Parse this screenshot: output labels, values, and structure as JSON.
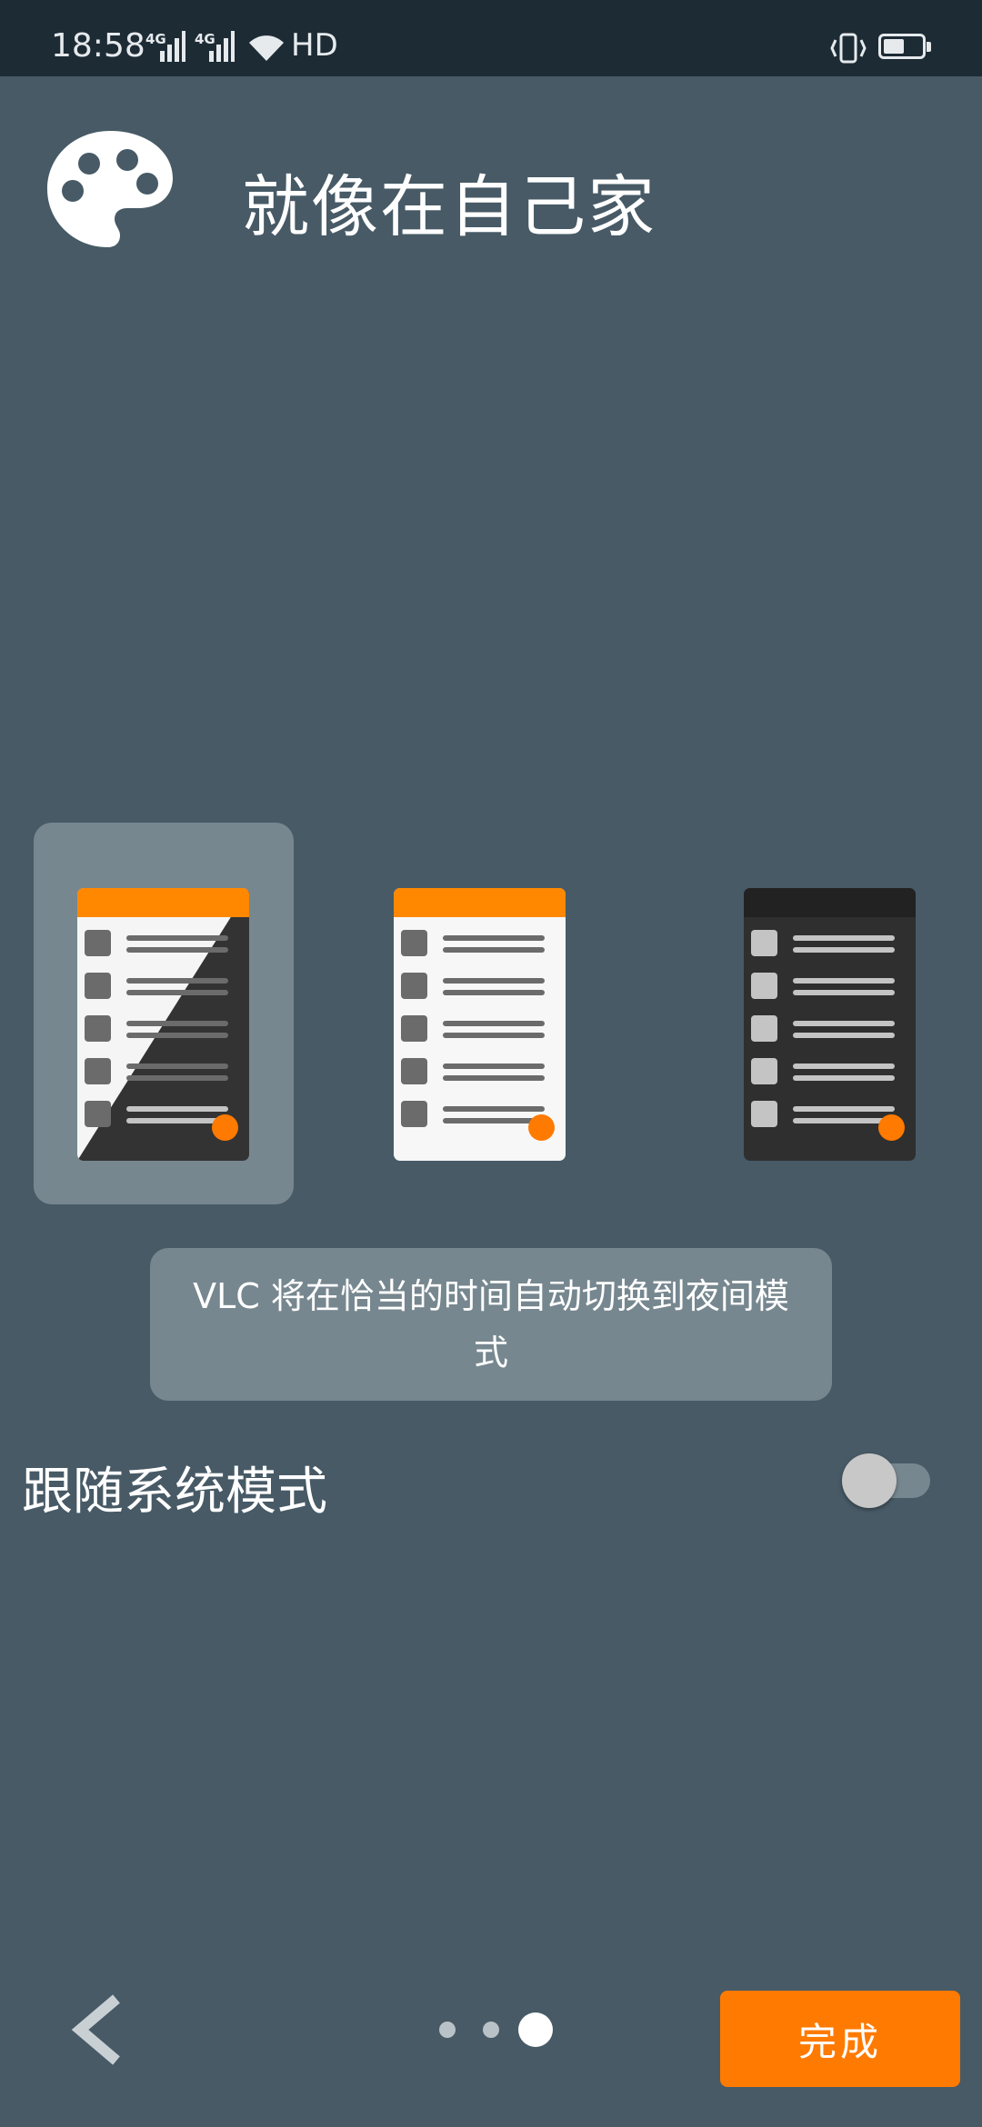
{
  "status_bar": {
    "time": "18:58",
    "net1": "4G",
    "net2": "4G",
    "hd": "HD"
  },
  "header": {
    "title": "就像在自己家",
    "icon": "palette-icon"
  },
  "themes": [
    {
      "name": "follow-daylight",
      "selected": true
    },
    {
      "name": "light",
      "selected": false
    },
    {
      "name": "dark",
      "selected": false
    }
  ],
  "info_text": "VLC 将在恰当的时间自动切换到夜间模式",
  "follow_system": {
    "label": "跟随系统模式",
    "enabled": false
  },
  "pagination": {
    "current": 3,
    "total": 3
  },
  "footer": {
    "done_label": "完成",
    "back_icon": "chevron-left-icon"
  },
  "colors": {
    "accent": "#ff7a00",
    "background": "#475a66",
    "statusbar": "#1d2b35"
  }
}
